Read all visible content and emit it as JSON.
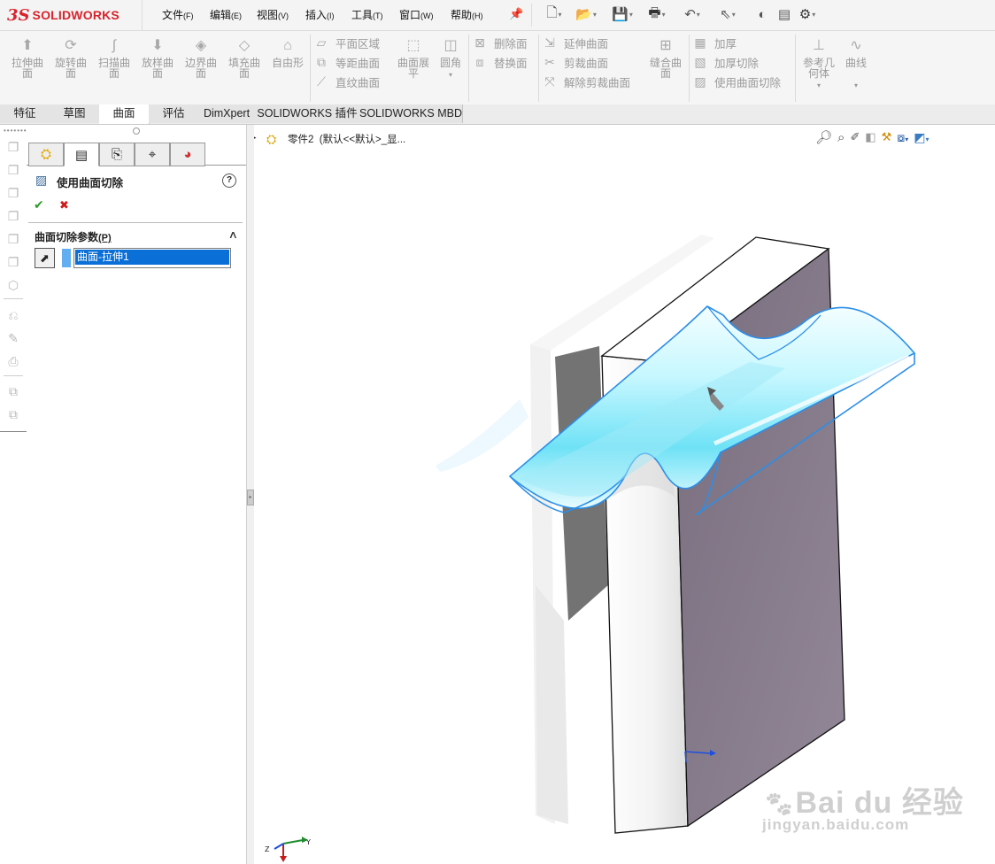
{
  "app": {
    "logo_ds": "3S",
    "logo_name": "SOLIDWORKS"
  },
  "menu": [
    {
      "label": "文件",
      "key": "(F)"
    },
    {
      "label": "编辑",
      "key": "(E)"
    },
    {
      "label": "视图",
      "key": "(V)"
    },
    {
      "label": "插入",
      "key": "(I)"
    },
    {
      "label": "工具",
      "key": "(T)"
    },
    {
      "label": "窗口",
      "key": "(W)"
    },
    {
      "label": "帮助",
      "key": "(H)"
    }
  ],
  "ribbon": {
    "large": [
      {
        "label1": "拉伸曲",
        "label2": "面",
        "icon": "extrude-surface-icon"
      },
      {
        "label1": "旋转曲",
        "label2": "面",
        "icon": "revolve-surface-icon"
      },
      {
        "label1": "扫描曲",
        "label2": "面",
        "icon": "sweep-surface-icon"
      },
      {
        "label1": "放样曲",
        "label2": "面",
        "icon": "loft-surface-icon"
      },
      {
        "label1": "边界曲",
        "label2": "面",
        "icon": "boundary-surface-icon"
      },
      {
        "label1": "填充曲",
        "label2": "面",
        "icon": "fill-surface-icon"
      },
      {
        "label1": "自由形",
        "label2": "",
        "icon": "freeform-icon"
      }
    ],
    "col1": [
      "平面区域",
      "等距曲面",
      "直纹曲面"
    ],
    "unfold": {
      "label1": "曲面展",
      "label2": "平"
    },
    "fillet": "圆角",
    "col2": [
      "删除面",
      "替换面"
    ],
    "col3": [
      "延伸曲面",
      "剪裁曲面",
      "解除剪裁曲面"
    ],
    "knit": {
      "label1": "缝合曲",
      "label2": "面"
    },
    "col4": [
      "加厚",
      "加厚切除",
      "使用曲面切除"
    ],
    "refgeom": {
      "label1": "参考几",
      "label2": "何体"
    },
    "curves": "曲线"
  },
  "tabs": [
    "特征",
    "草图",
    "曲面",
    "评估",
    "DimXpert",
    "SOLIDWORKS 插件",
    "SOLIDWORKS MBD"
  ],
  "active_tab": "曲面",
  "property_manager": {
    "title": "使用曲面切除",
    "help": "?",
    "ok": "✔",
    "cancel": "✖",
    "section_title": "曲面切除参数",
    "section_key": "(P)",
    "selection_value": "曲面-拉伸1",
    "collapse": "∧"
  },
  "tree": {
    "expander": "▸",
    "label": "零件2  (默认<<默认>_显..."
  },
  "triad": {
    "x": "X",
    "y": "Y",
    "z": "Z"
  },
  "watermark": {
    "brand": "Bai  du 经验",
    "url": "jingyan.baidu.com"
  },
  "colors": {
    "accent": "#2a6ec2",
    "surface": "#8de8f7",
    "dark_face": "#8c8090",
    "selection": "#0a6fd6"
  }
}
